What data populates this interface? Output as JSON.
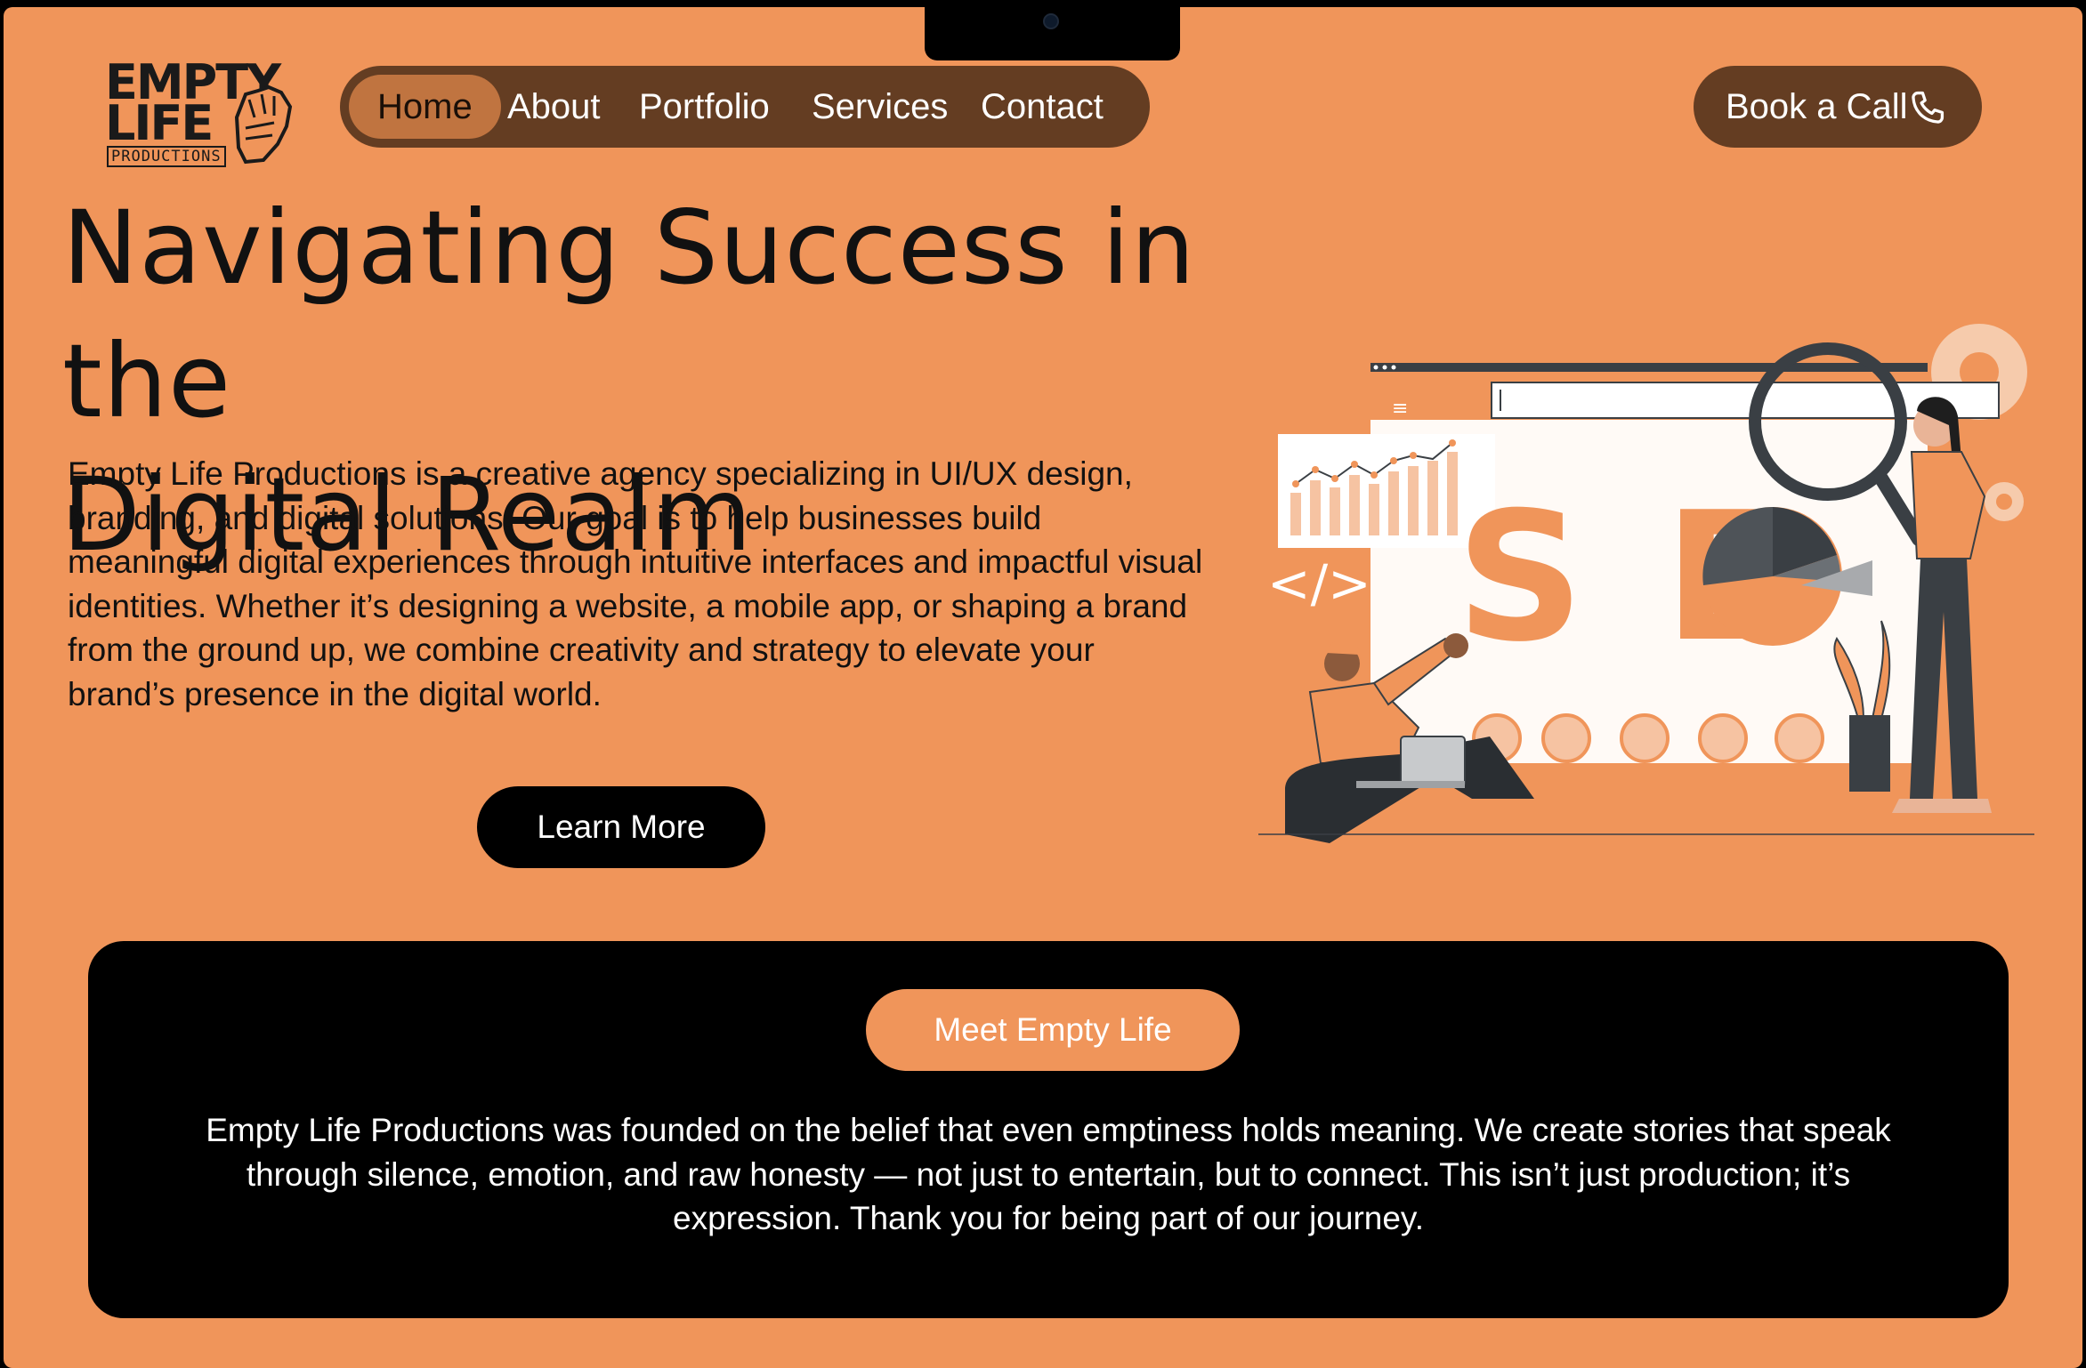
{
  "logo": {
    "line1": "EMPTY",
    "line2": "LIFE",
    "line3": "PRODUCTIONS"
  },
  "nav": {
    "items": [
      {
        "label": "Home",
        "active": true
      },
      {
        "label": "About",
        "active": false
      },
      {
        "label": "Portfolio",
        "active": false
      },
      {
        "label": "Services",
        "active": false
      },
      {
        "label": "Contact",
        "active": false
      }
    ]
  },
  "cta": {
    "book_label": "Book a Call",
    "icon": "phone-icon"
  },
  "hero": {
    "title_line1": "Navigating Success in the",
    "title_line2": "Digital Realm",
    "description": "Empty Life Productions is a creative agency specializing in UI/UX design, branding, and digital solutions. Our goal is to help businesses build meaningful digital experiences through intuitive interfaces and impactful visual identities. Whether it’s designing a website, a mobile app, or shaping a brand from the ground up, we combine creativity and strategy to elevate your brand’s presence in the digital world.",
    "button_label": "Learn More"
  },
  "illustration": {
    "seo_text": "SEO",
    "code_text": "</>"
  },
  "about": {
    "button_label": "Meet Empty Life",
    "text": "Empty Life Productions was founded on the belief that even emptiness holds meaning. We create stories that speak through silence, emotion, and raw honesty — not just to entertain, but to connect. This isn’t just production; it’s expression. Thank you for being part of our journey."
  },
  "colors": {
    "background": "#F0955A",
    "nav_bg": "#643D22",
    "nav_active": "#C07440",
    "dark": "#000000",
    "illustration_dark": "#3A3F44"
  }
}
